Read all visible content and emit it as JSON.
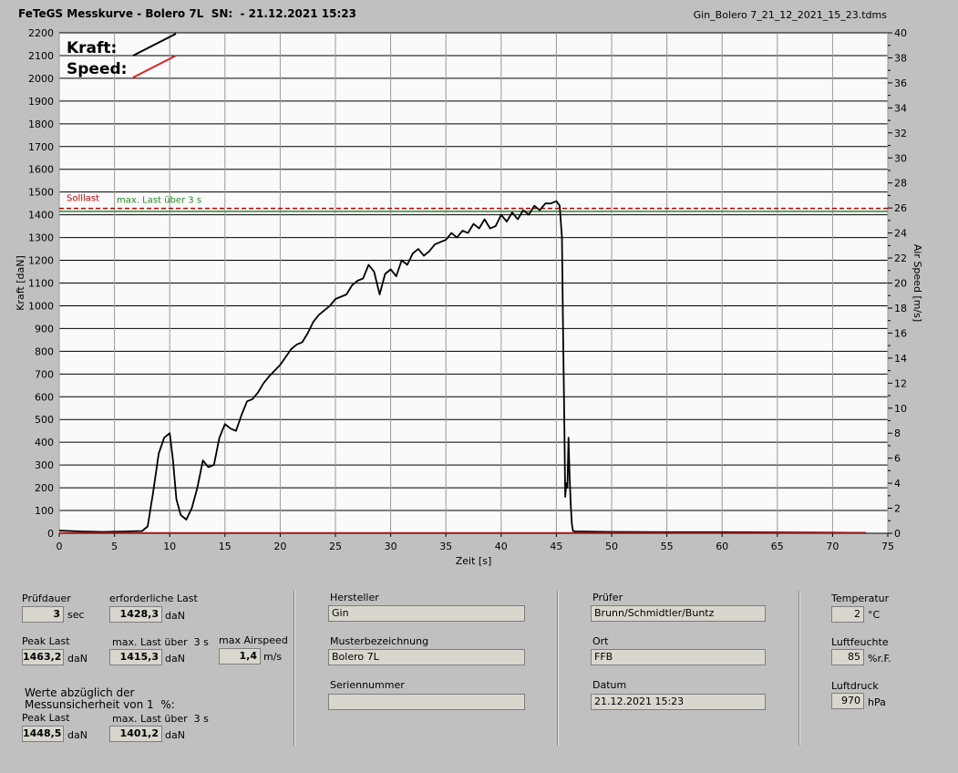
{
  "header": {
    "title": "FeTeGS Messkurve - Bolero 7L  SN:  - 21.12.2021 15:23",
    "filename": "Gin_Bolero 7_21_12_2021_15_23.tdms"
  },
  "chart_data": {
    "type": "line",
    "xlabel": "Zeit [s]",
    "ylabel": "Kraft [daN]",
    "y2label": "Air Speed [m/s]",
    "xlim": [
      0,
      75
    ],
    "ylim": [
      0,
      2200
    ],
    "y2lim": [
      0,
      40
    ],
    "xticks": [
      "0",
      "5",
      "10",
      "15",
      "20",
      "25",
      "30",
      "35",
      "40",
      "45",
      "50",
      "55",
      "60",
      "65",
      "70",
      "75"
    ],
    "yticks": [
      "0",
      "100",
      "200",
      "300",
      "400",
      "500",
      "600",
      "700",
      "800",
      "900",
      "1000",
      "1100",
      "1200",
      "1300",
      "1400",
      "1500",
      "1600",
      "1700",
      "1800",
      "1900",
      "2000",
      "2100",
      "2200"
    ],
    "y2ticks": [
      "0",
      "2",
      "4",
      "6",
      "8",
      "10",
      "12",
      "14",
      "16",
      "18",
      "20",
      "22",
      "24",
      "26",
      "28",
      "30",
      "32",
      "34",
      "36",
      "38",
      "40"
    ],
    "grid": true,
    "legend": [
      {
        "name": "Kraft:",
        "color": "#000000"
      },
      {
        "name": "Speed:",
        "color": "#e02020"
      }
    ],
    "annotations": [
      {
        "text": "Solllast",
        "y": 1428.3,
        "color": "#c00000",
        "style": "dashed"
      },
      {
        "text": "max. Last über  3 s",
        "y": 1415.3,
        "color": "#2a8a2a",
        "style": "solid"
      }
    ],
    "series": [
      {
        "name": "Kraft",
        "color": "#000000",
        "x": [
          0,
          2,
          4,
          6,
          7.5,
          8,
          8.5,
          9,
          9.5,
          10,
          10.3,
          10.6,
          11,
          11.5,
          12,
          12.5,
          13,
          13.5,
          14,
          14.5,
          15,
          15.5,
          16,
          16.5,
          17,
          17.5,
          18,
          18.5,
          19,
          20,
          21,
          21.5,
          22,
          22.5,
          23,
          23.5,
          24,
          24.5,
          25,
          25.5,
          26,
          26.5,
          27,
          27.5,
          28,
          28.5,
          29,
          29.5,
          30,
          30.5,
          31,
          31.5,
          32,
          32.5,
          33,
          33.5,
          34,
          34.5,
          35,
          35.5,
          36,
          36.5,
          37,
          37.5,
          38,
          38.5,
          39,
          39.5,
          40,
          40.5,
          41,
          41.5,
          42,
          42.5,
          43,
          43.5,
          44,
          44.5,
          45,
          45.3,
          45.5,
          45.6,
          45.7,
          45.8,
          45.9,
          46,
          46.1,
          46.2,
          46.3,
          46.4,
          46.5,
          46.7,
          47,
          50,
          55,
          60,
          65,
          70,
          73
        ],
        "y": [
          12,
          8,
          6,
          8,
          10,
          30,
          180,
          350,
          420,
          440,
          320,
          150,
          80,
          60,
          110,
          200,
          320,
          290,
          300,
          420,
          480,
          460,
          450,
          520,
          580,
          590,
          620,
          660,
          690,
          740,
          810,
          830,
          840,
          880,
          930,
          960,
          980,
          1000,
          1030,
          1040,
          1050,
          1090,
          1110,
          1120,
          1180,
          1150,
          1050,
          1140,
          1160,
          1130,
          1200,
          1180,
          1230,
          1250,
          1220,
          1240,
          1270,
          1280,
          1290,
          1320,
          1300,
          1330,
          1320,
          1360,
          1340,
          1380,
          1340,
          1350,
          1400,
          1370,
          1410,
          1380,
          1420,
          1400,
          1440,
          1420,
          1450,
          1450,
          1460,
          1440,
          1300,
          900,
          550,
          160,
          220,
          200,
          420,
          250,
          120,
          40,
          10,
          8,
          8,
          6,
          5,
          5,
          4,
          3,
          2
        ]
      },
      {
        "name": "Speed",
        "color": "#e02020",
        "x": [
          0,
          73
        ],
        "y": [
          0.05,
          0.05
        ]
      }
    ]
  },
  "panel": {
    "pruefdauer": {
      "label": "Prüfdauer",
      "value": "3",
      "unit": "sec"
    },
    "erforderliche_last": {
      "label": "erforderliche Last",
      "value": "1428,3",
      "unit": "daN"
    },
    "peak_last": {
      "label": "Peak Last",
      "value": "1463,2",
      "unit": "daN"
    },
    "max_last_3s": {
      "label": "max. Last über  3 s",
      "value": "1415,3",
      "unit": "daN"
    },
    "max_airspeed": {
      "label": "max Airspeed",
      "value": "1,4",
      "unit": "m/s"
    },
    "werte_text": "Werte abzüglich der\nMessunsicherheit von 1  %:",
    "peak_last_abz": {
      "label": "Peak Last",
      "value": "1448,5",
      "unit": "daN"
    },
    "max_last_abz": {
      "label": "max. Last über  3 s",
      "value": "1401,2",
      "unit": "daN"
    },
    "hersteller": {
      "label": "Hersteller",
      "value": "Gin"
    },
    "musterbezeichnung": {
      "label": "Musterbezeichnung",
      "value": "Bolero 7L"
    },
    "seriennummer": {
      "label": "Seriennummer",
      "value": ""
    },
    "pruefer": {
      "label": "Prüfer",
      "value": "Brunn/Schmidtler/Buntz"
    },
    "ort": {
      "label": "Ort",
      "value": "FFB"
    },
    "datum": {
      "label": "Datum",
      "value": "21.12.2021 15:23"
    },
    "temperatur": {
      "label": "Temperatur",
      "value": "2",
      "unit": "°C"
    },
    "luftfeuchte": {
      "label": "Luftfeuchte",
      "value": "85",
      "unit": "%r.F."
    },
    "luftdruck": {
      "label": "Luftdruck",
      "value": "970",
      "unit": "hPa"
    }
  }
}
